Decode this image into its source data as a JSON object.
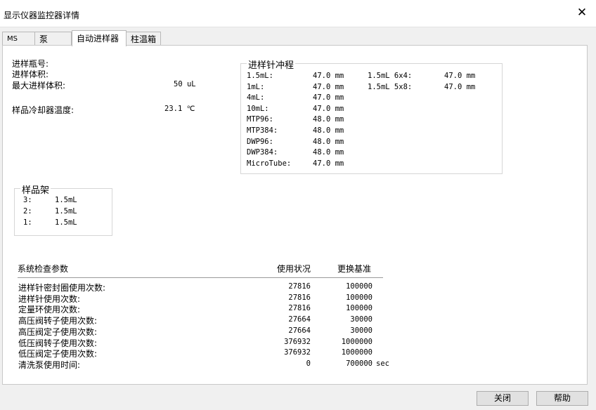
{
  "window": {
    "title": "显示仪器监控器详情"
  },
  "tabs": [
    {
      "label": "MS"
    },
    {
      "label": "泵"
    },
    {
      "label": "自动进样器"
    },
    {
      "label": "柱温箱"
    }
  ],
  "info": {
    "vial_label": "进样瓶号:",
    "volume_label": "进样体积:",
    "max_volume_label": "最大进样体积:",
    "max_volume_value": "50 uL",
    "cooler_temp_label": "样品冷却器温度:",
    "cooler_temp_value": "23.1 ℃"
  },
  "needle_stroke": {
    "title": "进样针冲程",
    "rows": [
      {
        "label": "1.5mL:",
        "value": "47.0 mm"
      },
      {
        "label": "1mL:",
        "value": "47.0 mm"
      },
      {
        "label": "4mL:",
        "value": "47.0 mm"
      },
      {
        "label": "10mL:",
        "value": "47.0 mm"
      },
      {
        "label": "MTP96:",
        "value": "48.0 mm"
      },
      {
        "label": "MTP384:",
        "value": "48.0 mm"
      },
      {
        "label": "DWP96:",
        "value": "48.0 mm"
      },
      {
        "label": "DWP384:",
        "value": "48.0 mm"
      },
      {
        "label": "MicroTube:",
        "value": "47.0 mm"
      }
    ],
    "rows2": [
      {
        "label": "1.5mL 6x4:",
        "value": "47.0 mm"
      },
      {
        "label": "1.5mL 5x8:",
        "value": "47.0 mm"
      }
    ]
  },
  "rack": {
    "title": "样品架",
    "rows": [
      {
        "label": "3:",
        "value": "1.5mL"
      },
      {
        "label": "2:",
        "value": "1.5mL"
      },
      {
        "label": "1:",
        "value": "1.5mL"
      }
    ]
  },
  "system_check": {
    "header_param": "系统检查参数",
    "header_usage": "使用状况",
    "header_replace": "更换基准",
    "rows": [
      {
        "label": "进样针密封圈使用次数:",
        "usage": "27816",
        "replace": "100000",
        "unit": ""
      },
      {
        "label": "进样针使用次数:",
        "usage": "27816",
        "replace": "100000",
        "unit": ""
      },
      {
        "label": "定量环使用次数:",
        "usage": "27816",
        "replace": "100000",
        "unit": ""
      },
      {
        "label": "高压阀转子使用次数:",
        "usage": "27664",
        "replace": "30000",
        "unit": ""
      },
      {
        "label": "高压阀定子使用次数:",
        "usage": "27664",
        "replace": "30000",
        "unit": ""
      },
      {
        "label": "低压阀转子使用次数:",
        "usage": "376932",
        "replace": "1000000",
        "unit": ""
      },
      {
        "label": "低压阀定子使用次数:",
        "usage": "376932",
        "replace": "1000000",
        "unit": ""
      },
      {
        "label": "清洗泵使用时间:",
        "usage": "0",
        "replace": "700000",
        "unit": "sec"
      }
    ]
  },
  "buttons": {
    "close": "关闭",
    "help": "帮助"
  }
}
